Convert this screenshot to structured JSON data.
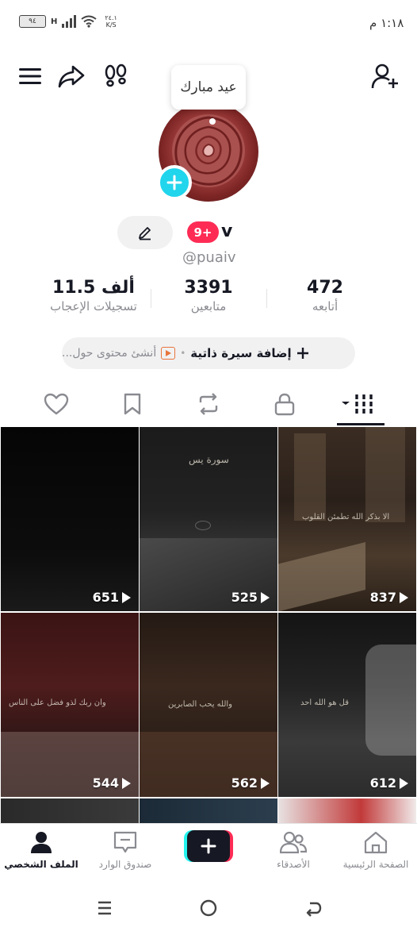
{
  "status_bar": {
    "time": "١:١٨ م",
    "battery": "٩٤",
    "network": "H",
    "speed_value": "٢٤.١",
    "speed_unit": "K/S"
  },
  "header": {
    "add_friend_icon": "person-add-icon",
    "menu_icon": "hamburger-icon",
    "share_icon": "share-arrow-icon",
    "footprint_icon": "footprints-icon"
  },
  "profile": {
    "note_bubble": "عيد مبارك",
    "nickname": "v",
    "notification_badge": "9+",
    "handle": "@puaiv",
    "stats": {
      "following_count": "472",
      "following_label": "أتابعه",
      "followers_count": "3391",
      "followers_label": "متابعين",
      "likes_count": "11.5 ألف",
      "likes_label": "تسجيلات الإعجاب"
    },
    "bio_add": "إضافة سيرة ذاتية",
    "bio_hint": "أنشئ محتوى حول..."
  },
  "tabs": [
    {
      "icon": "grid-icon",
      "active": true
    },
    {
      "icon": "lock-icon",
      "active": false
    },
    {
      "icon": "repost-icon",
      "active": false
    },
    {
      "icon": "bookmark-icon",
      "active": false
    },
    {
      "icon": "heart-icon",
      "active": false
    }
  ],
  "videos": [
    {
      "views": "837",
      "caption": "الا بذكر الله تطمئن القلوب"
    },
    {
      "views": "525",
      "caption": "سورة يس"
    },
    {
      "views": "651",
      "caption": ""
    },
    {
      "views": "612",
      "caption": "قل هو الله احد"
    },
    {
      "views": "562",
      "caption": "والله يحب الصابرين"
    },
    {
      "views": "544",
      "caption": "وان ربك لذو فضل على الناس"
    }
  ],
  "bottom_nav": {
    "home": "الصفحة الرئيسية",
    "friends": "الأصدقاء",
    "inbox": "صندوق الوارد",
    "profile": "الملف الشخصي"
  },
  "colors": {
    "accent_red": "#fe2c55",
    "accent_cyan": "#20d5ec",
    "text": "#161823",
    "muted": "#8a8b91"
  }
}
